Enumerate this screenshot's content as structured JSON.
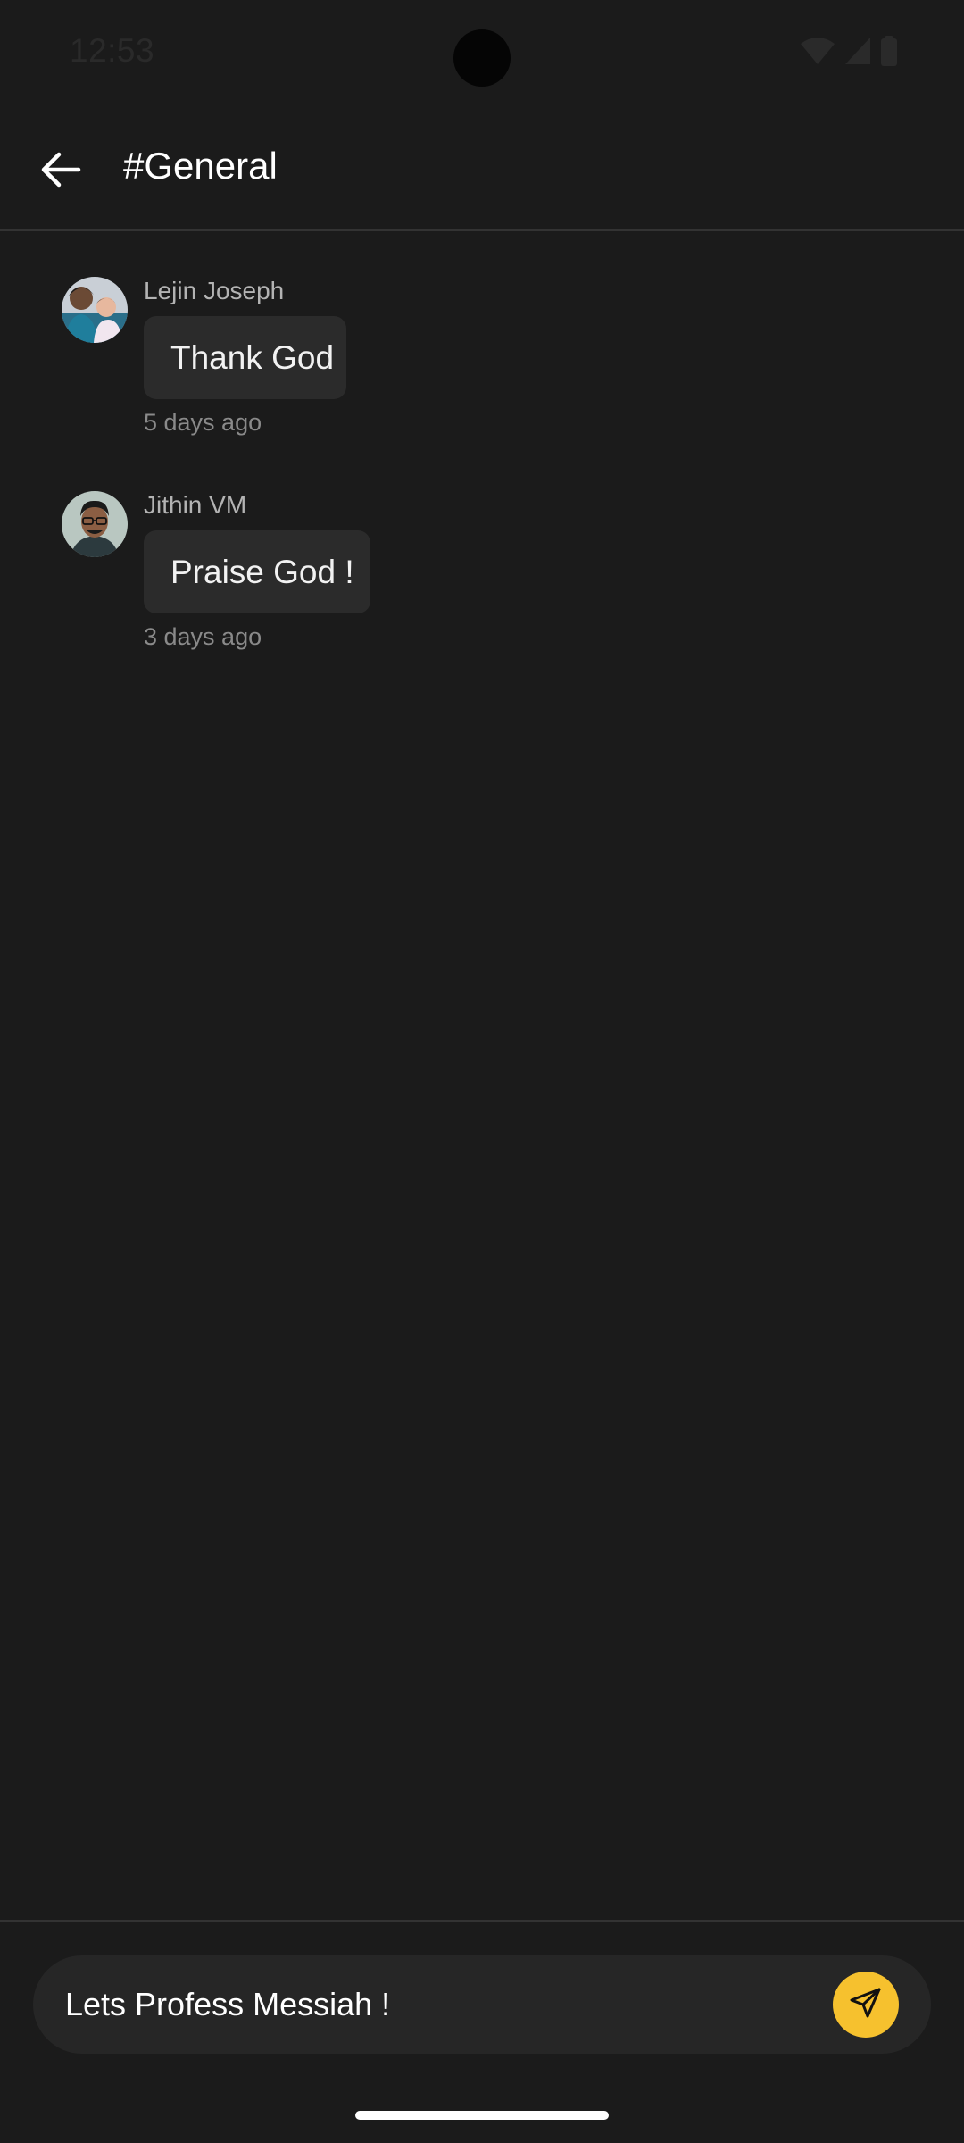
{
  "status_bar": {
    "time": "12:53",
    "icons": [
      "wifi-icon",
      "cell-signal-icon",
      "battery-icon"
    ]
  },
  "header": {
    "back_icon": "arrow-left-icon",
    "title": "#General"
  },
  "messages": [
    {
      "sender": "Lejin Joseph",
      "text": "Thank God",
      "time": "5 days ago",
      "avatar": "avatar-photo"
    },
    {
      "sender": "Jithin VM",
      "text": "Praise God !",
      "time": "3 days ago",
      "avatar": "avatar-photo"
    }
  ],
  "composer": {
    "value": "Lets Profess Messiah !",
    "send_icon": "send-icon"
  },
  "colors": {
    "background": "#1b1b1b",
    "bubble": "#2b2b2b",
    "accent": "#f6c12e"
  }
}
